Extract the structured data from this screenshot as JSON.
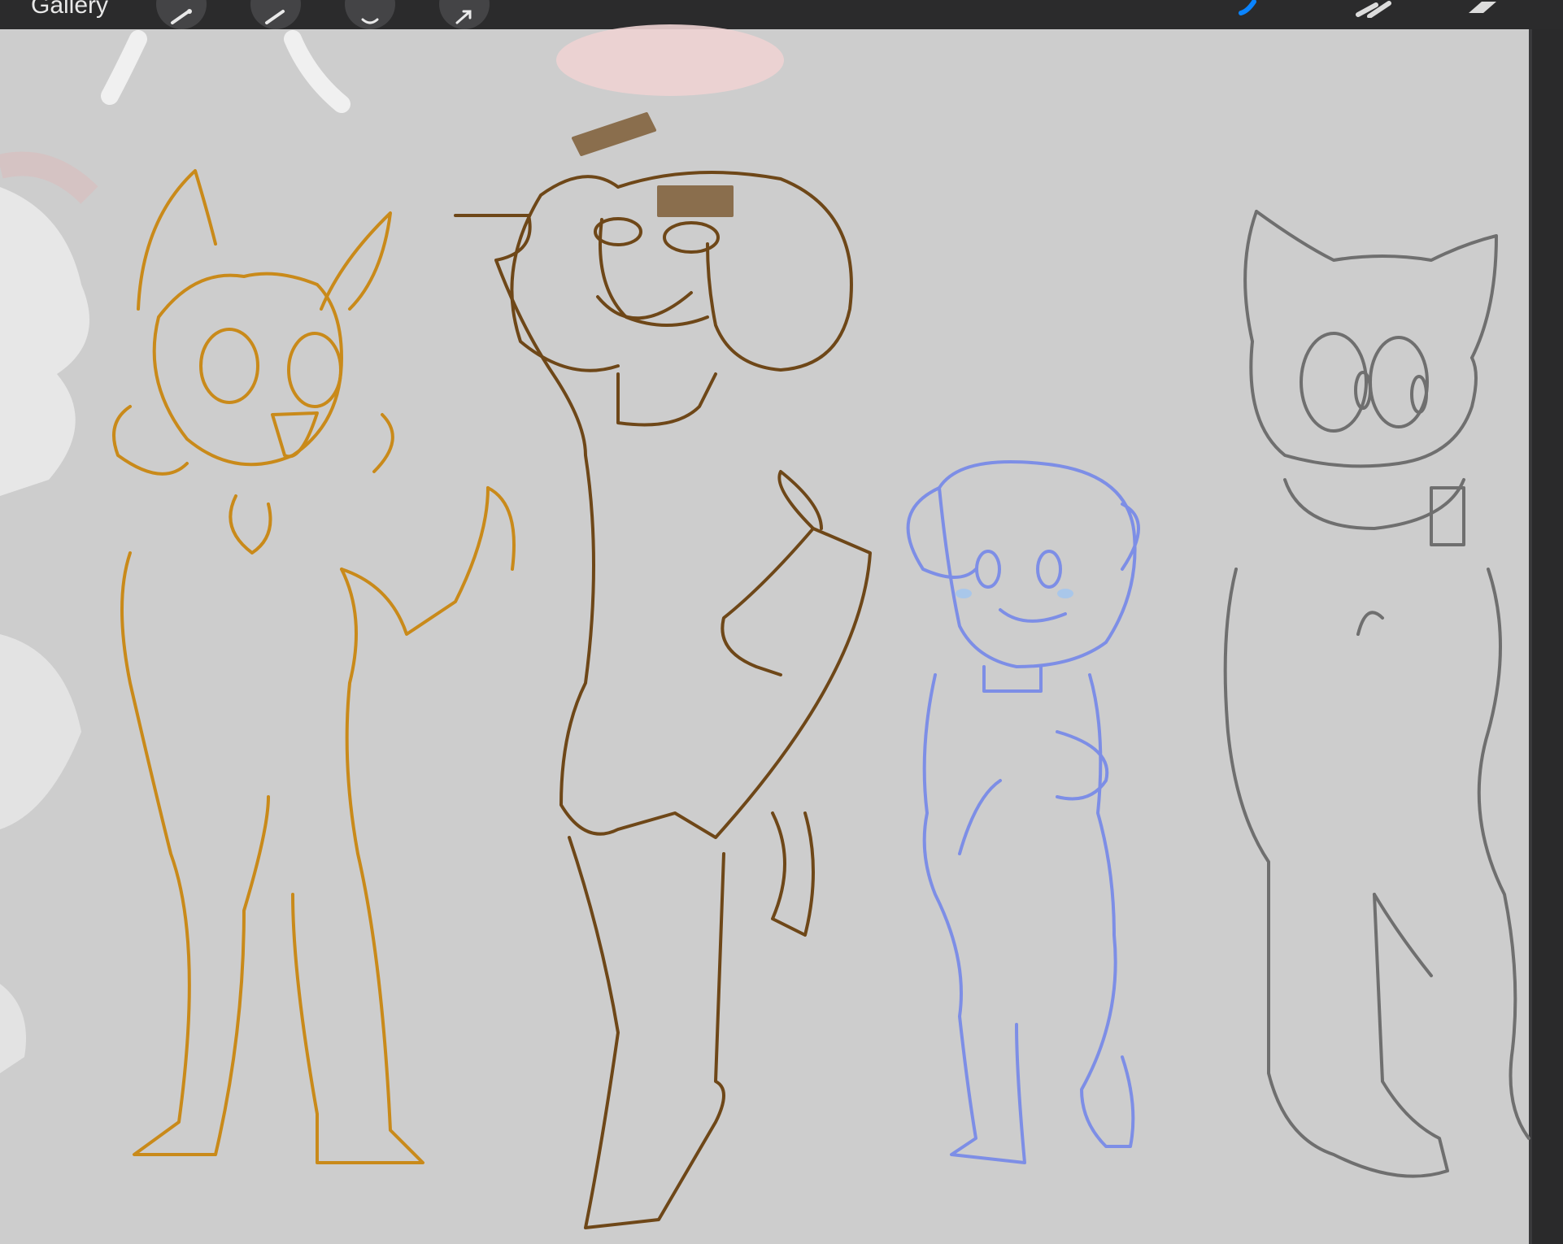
{
  "toolbar": {
    "gallery_label": "Gallery",
    "left_tools": [
      {
        "icon": "wrench-icon"
      },
      {
        "icon": "magic-wand-icon"
      },
      {
        "icon": "selection-icon"
      },
      {
        "icon": "transform-arrow-icon"
      }
    ],
    "right_tools": [
      {
        "icon": "brush-icon",
        "active": true
      },
      {
        "icon": "smudge-icon",
        "active": false
      },
      {
        "icon": "eraser-icon",
        "active": false
      }
    ],
    "active_color": "#0a84ff"
  },
  "canvas": {
    "background_color": "#cdcdcd",
    "characters": [
      {
        "name": "fox-character",
        "line_color": "#c98a1a"
      },
      {
        "name": "dog-character",
        "line_color": "#6e4718"
      },
      {
        "name": "cat-girl-character",
        "line_color": "#7d8ee6"
      },
      {
        "name": "cat-phone-character",
        "line_color": "#6f6f6f"
      }
    ],
    "sketch_guide_color": "#9aa6e8"
  }
}
